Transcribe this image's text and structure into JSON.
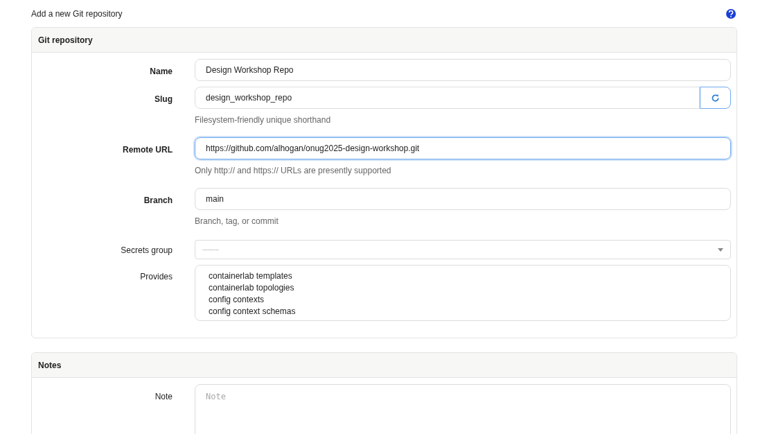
{
  "page_title": "Add a new Git repository",
  "panels": [
    {
      "title": "Git repository",
      "fields": [
        {
          "kind": "text",
          "label": "Name",
          "required": true,
          "value": "Design Workshop Repo",
          "focused": false
        },
        {
          "kind": "text_button",
          "label": "Slug",
          "required": true,
          "value": "design_workshop_repo",
          "focused": false,
          "help": "Filesystem-friendly unique shorthand"
        },
        {
          "kind": "text",
          "label": "Remote URL",
          "required": true,
          "value": "https://github.com/alhogan/onug2025-design-workshop.git",
          "focused": true,
          "help": "Only http:// and https:// URLs are presently supported"
        },
        {
          "kind": "text",
          "label": "Branch",
          "required": true,
          "value": "main",
          "focused": false,
          "help": "Branch, tag, or commit"
        },
        {
          "kind": "select",
          "label": "Secrets group",
          "required": false,
          "placeholder": "---------"
        },
        {
          "kind": "multiselect",
          "label": "Provides",
          "required": false,
          "options": [
            "containerlab templates",
            "containerlab topologies",
            "config contexts",
            "config context schemas"
          ]
        }
      ]
    },
    {
      "title": "Notes",
      "fields": [
        {
          "kind": "textarea",
          "label": "Note",
          "required": false,
          "placeholder": "Note"
        }
      ]
    }
  ]
}
